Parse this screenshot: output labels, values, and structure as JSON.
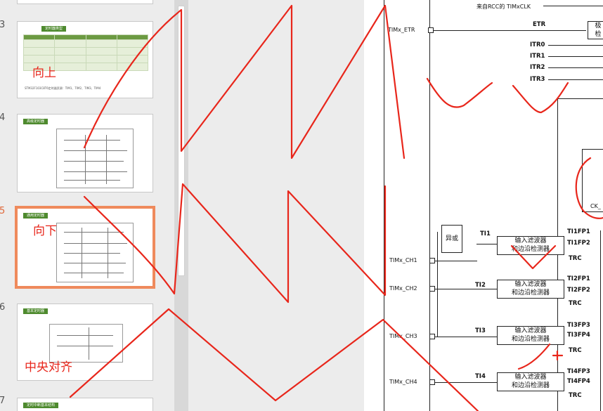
{
  "thumbnails": [
    {
      "num": "3",
      "title": "定时器类型",
      "note": "STM32F103C8T6定时器资源：TIM1、TIM2、TIM3、TIM4"
    },
    {
      "num": "4",
      "title": "高级定时器"
    },
    {
      "num": "5",
      "title": "通用定时器"
    },
    {
      "num": "6",
      "title": "基本定时器"
    },
    {
      "num": "7",
      "title": "定时中断基本结构"
    }
  ],
  "annotations": {
    "up": "向上",
    "down": "向下",
    "center": "中央对齐"
  },
  "diagram": {
    "rcc_clk": "来自RCC的 TIMxCLK",
    "etr_pin": "TIMx_ETR",
    "etr": "ETR",
    "itr0": "ITR0",
    "itr1": "ITR1",
    "itr2": "ITR2",
    "itr3": "ITR3",
    "box_trigger": "极",
    "box_trigger2": "检",
    "ck": "CK_",
    "xor": "异或",
    "ti1": "TI1",
    "ti2": "TI2",
    "ti3": "TI3",
    "ti4": "TI4",
    "ch1": "TIMx_CH1",
    "ch2": "TIMx_CH2",
    "ch3": "TIMx_CH3",
    "ch4": "TIMx_CH4",
    "filter_line1": "输入滤波器",
    "filter_line2": "和边沿检测器",
    "ti1fp1": "TI1FP1",
    "ti1fp2": "TI1FP2",
    "ti2fp1": "TI2FP1",
    "ti2fp2": "TI2FP2",
    "ti3fp3": "TI3FP3",
    "ti3fp4": "TI3FP4",
    "ti4fp3": "TI4FP3",
    "ti4fp4": "TI4FP4",
    "trc": "TRC"
  }
}
